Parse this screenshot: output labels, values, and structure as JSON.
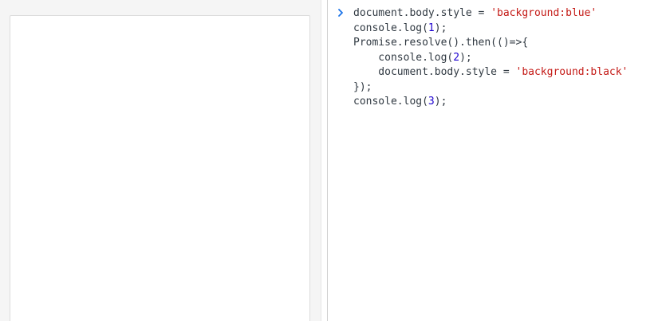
{
  "console": {
    "prompt_icon": "chevron-right-icon",
    "lines": [
      [
        {
          "t": "document.body.style = ",
          "k": "plain"
        },
        {
          "t": "'background:blue'",
          "k": "str"
        }
      ],
      [
        {
          "t": "console.log(",
          "k": "plain"
        },
        {
          "t": "1",
          "k": "num"
        },
        {
          "t": ");",
          "k": "plain"
        }
      ],
      [
        {
          "t": "Promise.resolve().then(()=>{",
          "k": "plain"
        }
      ],
      [
        {
          "t": "    console.log(",
          "k": "plain"
        },
        {
          "t": "2",
          "k": "num"
        },
        {
          "t": ");",
          "k": "plain"
        }
      ],
      [
        {
          "t": "    document.body.style = ",
          "k": "plain"
        },
        {
          "t": "'background:black'",
          "k": "str"
        }
      ],
      [
        {
          "t": "});",
          "k": "plain"
        }
      ],
      [
        {
          "t": "console.log(",
          "k": "plain"
        },
        {
          "t": "3",
          "k": "num"
        },
        {
          "t": ");",
          "k": "plain"
        }
      ]
    ]
  },
  "colors": {
    "string": "#c41a16",
    "number": "#1c00cf",
    "text": "#303942",
    "prompt": "#1a73e8"
  }
}
